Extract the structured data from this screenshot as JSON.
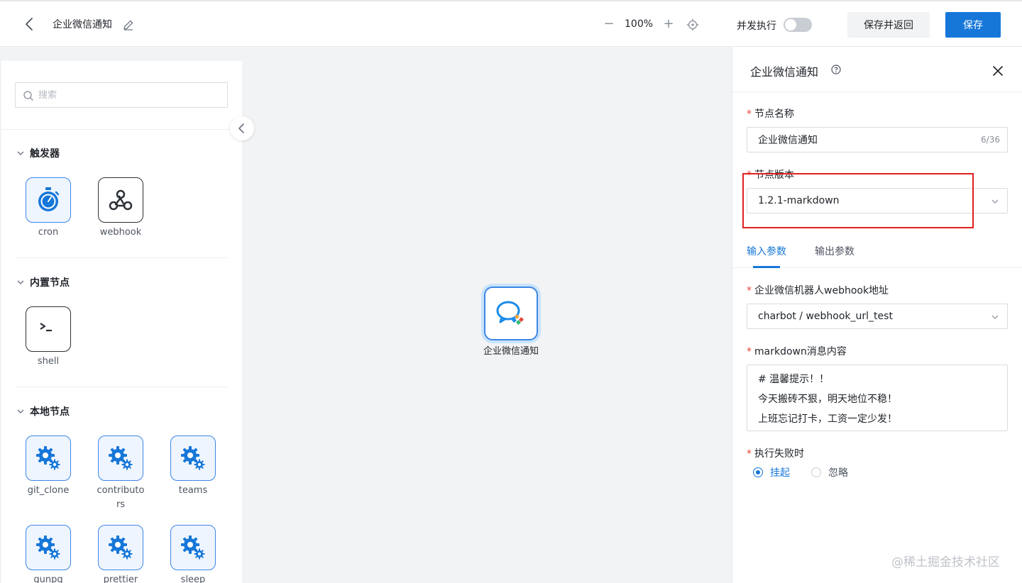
{
  "header": {
    "title": "企业微信通知",
    "zoom_minus": "−",
    "zoom_level": "100%",
    "zoom_plus": "+",
    "concurrent_label": "并发执行",
    "concurrent_enabled": false,
    "save_return_label": "保存并返回",
    "save_label": "保存"
  },
  "palette": {
    "search_placeholder": "搜索",
    "sections": [
      {
        "label": "触发器",
        "nodes": [
          {
            "label": "cron",
            "icon": "stopwatch-icon"
          },
          {
            "label": "webhook",
            "icon": "webhook-icon"
          }
        ]
      },
      {
        "label": "内置节点",
        "nodes": [
          {
            "label": "shell",
            "icon": "terminal-icon"
          }
        ]
      },
      {
        "label": "本地节点",
        "nodes": [
          {
            "label": "git_clone",
            "icon": "gear-icon"
          },
          {
            "label": "contributors",
            "icon": "gear-icon"
          },
          {
            "label": "teams",
            "icon": "gear-icon"
          },
          {
            "label": "gunpg",
            "icon": "gear-icon"
          },
          {
            "label": "prettier",
            "icon": "gear-icon"
          },
          {
            "label": "sleep",
            "icon": "gear-icon"
          }
        ]
      }
    ]
  },
  "canvas": {
    "node_label": "企业微信通知",
    "node_icon": "wecom-chat-icon"
  },
  "panel": {
    "title": "企业微信通知",
    "node_name_label": "节点名称",
    "node_name_value": "企业微信通知",
    "node_name_count": "6/36",
    "version_label": "节点版本",
    "version_value": "1.2.1-markdown",
    "tabs": [
      {
        "label": "输入参数",
        "active": true
      },
      {
        "label": "输出参数",
        "active": false
      }
    ],
    "webhook_label": "企业微信机器人webhook地址",
    "webhook_value": "charbot / webhook_url_test",
    "content_label": "markdown消息内容",
    "content_lines": [
      "# 温馨提示！！",
      "今天搬砖不狠，明天地位不稳！",
      "上班忘记打卡，工资一定少发！"
    ],
    "on_fail_label": "执行失败时",
    "on_fail_options": [
      {
        "label": "挂起",
        "selected": true
      },
      {
        "label": "忽略",
        "selected": false
      }
    ]
  },
  "watermark": "@稀土掘金技术社区",
  "colors": {
    "primary": "#1677d9",
    "highlight": "#e02020",
    "required": "#e8453c"
  }
}
